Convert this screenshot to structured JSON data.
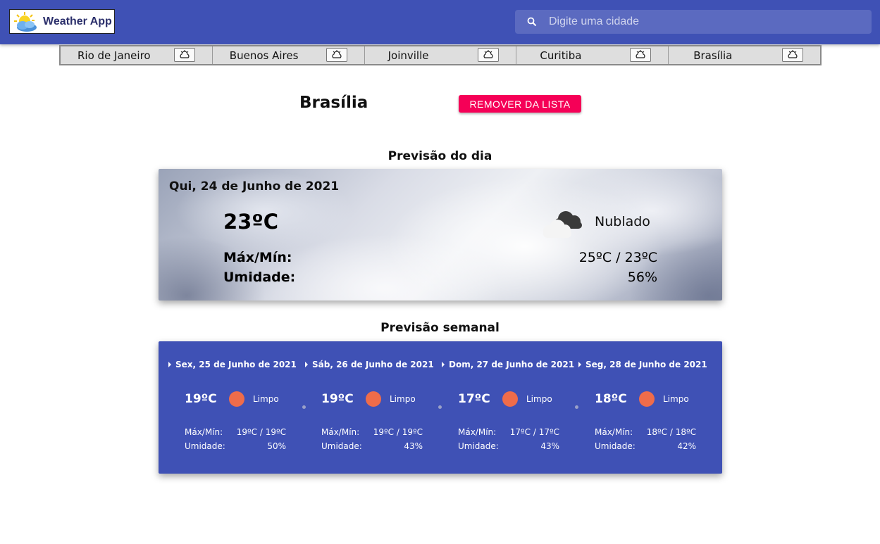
{
  "app": {
    "title": "Weather App",
    "logo_icon": "sun-cloud-logo-icon"
  },
  "search": {
    "placeholder": "Digite uma cidade",
    "value": "",
    "icon": "search-icon"
  },
  "city_tabs": [
    {
      "name": "Rio de Janeiro",
      "icon": "weather-icon"
    },
    {
      "name": "Buenos Aires",
      "icon": "weather-icon"
    },
    {
      "name": "Joinville",
      "icon": "weather-icon"
    },
    {
      "name": "Curitiba",
      "icon": "weather-icon"
    },
    {
      "name": "Brasília",
      "icon": "weather-icon"
    }
  ],
  "city": {
    "name": "Brasília",
    "remove_label": "REMOVER DA LISTA"
  },
  "today": {
    "section_title": "Previsão do dia",
    "date": "Qui, 24 de Junho de 2021",
    "temp": "23ºC",
    "condition": "Nublado",
    "condition_icon": "cloud-icon",
    "maxmin_label": "Máx/Mín:",
    "maxmin_value": "25ºC / 23ºC",
    "humidity_label": "Umidade:",
    "humidity_value": "56%"
  },
  "week": {
    "section_title": "Previsão semanal",
    "days": [
      {
        "date": "Sex, 25 de Junho de 2021",
        "temp": "19ºC",
        "condition": "Limpo",
        "maxmin_label": "Máx/Mín:",
        "maxmin": "19ºC / 19ºC",
        "humidity_label": "Umidade:",
        "humidity": "50%"
      },
      {
        "date": "Sáb, 26 de Junho de 2021",
        "temp": "19ºC",
        "condition": "Limpo",
        "maxmin_label": "Máx/Mín:",
        "maxmin": "19ºC / 19ºC",
        "humidity_label": "Umidade:",
        "humidity": "43%"
      },
      {
        "date": "Dom, 27 de Junho de 2021",
        "temp": "17ºC",
        "condition": "Limpo",
        "maxmin_label": "Máx/Mín:",
        "maxmin": "17ºC / 17ºC",
        "humidity_label": "Umidade:",
        "humidity": "43%"
      },
      {
        "date": "Seg, 28 de Junho de 2021",
        "temp": "18ºC",
        "condition": "Limpo",
        "maxmin_label": "Máx/Mín:",
        "maxmin": "18ºC / 18ºC",
        "humidity_label": "Umidade:",
        "humidity": "42%"
      }
    ]
  },
  "colors": {
    "primary": "#3f51b5",
    "accent": "#f50057",
    "sun": "#ef6c4a"
  }
}
